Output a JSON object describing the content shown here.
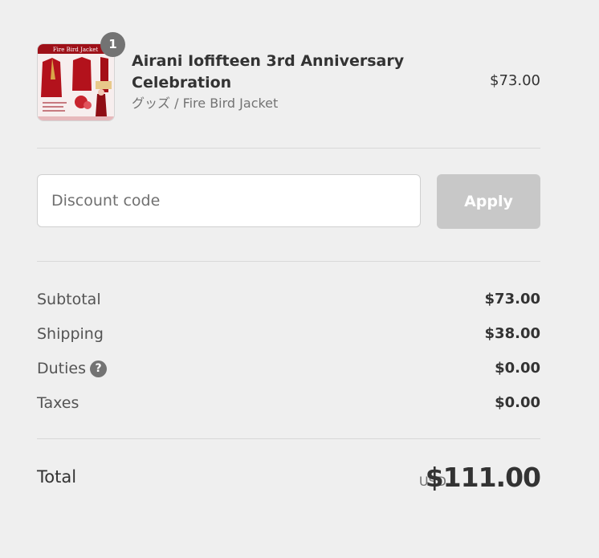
{
  "product": {
    "image_alt": "Fire Bird Jacket",
    "image_banner": "Fire Bird Jacket",
    "quantity": "1",
    "title": "Airani Iofifteen 3rd Anniversary Celebration",
    "variant": "グッズ / Fire Bird Jacket",
    "price": "$73.00"
  },
  "discount": {
    "placeholder": "Discount code",
    "apply_label": "Apply"
  },
  "costs": {
    "subtotal_label": "Subtotal",
    "subtotal_value": "$73.00",
    "shipping_label": "Shipping",
    "shipping_value": "$38.00",
    "duties_label": "Duties",
    "duties_help_icon": "?",
    "duties_value": "$0.00",
    "taxes_label": "Taxes",
    "taxes_value": "$0.00"
  },
  "total": {
    "label": "Total",
    "currency": "USD",
    "amount": "$111.00"
  },
  "colors": {
    "background": "#efefef",
    "apply_disabled": "#c8c8c8",
    "badge": "#737373",
    "product_red": "#b3121c"
  }
}
